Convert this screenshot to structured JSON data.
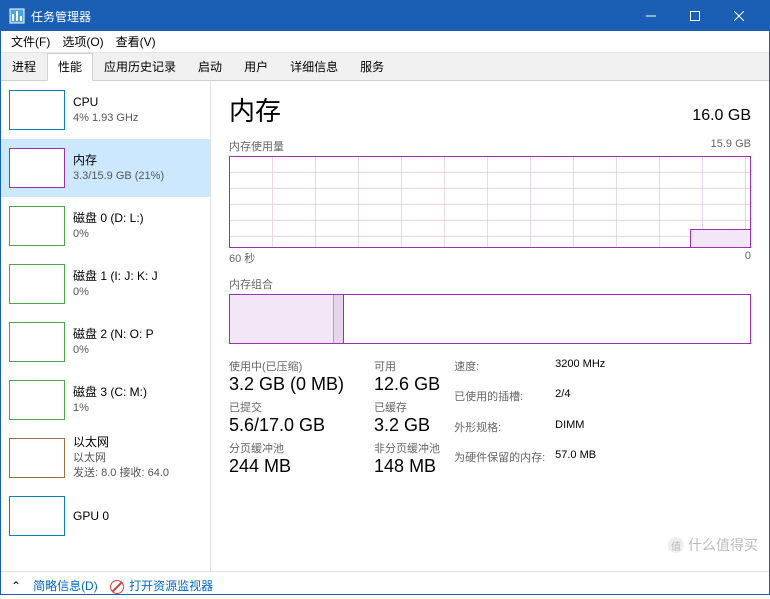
{
  "window": {
    "title": "任务管理器"
  },
  "menu": {
    "file": "文件(F)",
    "options": "选项(O)",
    "view": "查看(V)"
  },
  "tabs": [
    "进程",
    "性能",
    "应用历史记录",
    "启动",
    "用户",
    "详细信息",
    "服务"
  ],
  "activeTab": 1,
  "sidebar": [
    {
      "name": "CPU",
      "sub": "4% 1.93 GHz",
      "kind": "cpu"
    },
    {
      "name": "内存",
      "sub": "3.3/15.9 GB (21%)",
      "kind": "mem",
      "selected": true
    },
    {
      "name": "磁盘 0 (D: L:)",
      "sub": "0%",
      "kind": "disk"
    },
    {
      "name": "磁盘 1 (I: J: K: J",
      "sub": "0%",
      "kind": "disk"
    },
    {
      "name": "磁盘 2 (N: O: P",
      "sub": "0%",
      "kind": "disk"
    },
    {
      "name": "磁盘 3 (C: M:)",
      "sub": "1%",
      "kind": "disk"
    },
    {
      "name": "以太网",
      "sub": "以太网",
      "sub2": "发送: 8.0 接收: 64.0",
      "kind": "eth"
    },
    {
      "name": "GPU 0",
      "sub": "",
      "kind": "gpu"
    }
  ],
  "main": {
    "title": "内存",
    "total": "16.0 GB",
    "usageLabel": "内存使用量",
    "usageMax": "15.9 GB",
    "xLeft": "60 秒",
    "xRight": "0",
    "compLabel": "内存组合"
  },
  "stats": {
    "inUseLabel": "使用中(已压缩)",
    "inUse": "3.2 GB (0 MB)",
    "availLabel": "可用",
    "avail": "12.6 GB",
    "commitLabel": "已提交",
    "commit": "5.6/17.0 GB",
    "cachedLabel": "已缓存",
    "cached": "3.2 GB",
    "pagedLabel": "分页缓冲池",
    "paged": "244 MB",
    "nonpagedLabel": "非分页缓冲池",
    "nonpaged": "148 MB"
  },
  "info": {
    "speedLabel": "速度:",
    "speed": "3200 MHz",
    "slotsLabel": "已使用的插槽:",
    "slots": "2/4",
    "formLabel": "外形规格:",
    "form": "DIMM",
    "hwLabel": "为硬件保留的内存:",
    "hw": "57.0 MB"
  },
  "footer": {
    "fewer": "简略信息(D)",
    "resmon": "打开资源监视器"
  },
  "watermark": "什么值得买",
  "chart_data": {
    "type": "line",
    "title": "内存使用量",
    "xlabel": "60 秒",
    "ylabel": "",
    "ylim": [
      0,
      15.9
    ],
    "x": [
      60,
      55,
      50,
      45,
      40,
      35,
      30,
      25,
      20,
      15,
      10,
      5,
      0
    ],
    "values": [
      0,
      0,
      0,
      0,
      0,
      0,
      0,
      0,
      0,
      0,
      0,
      3.3,
      3.3
    ],
    "unit": "GB"
  }
}
